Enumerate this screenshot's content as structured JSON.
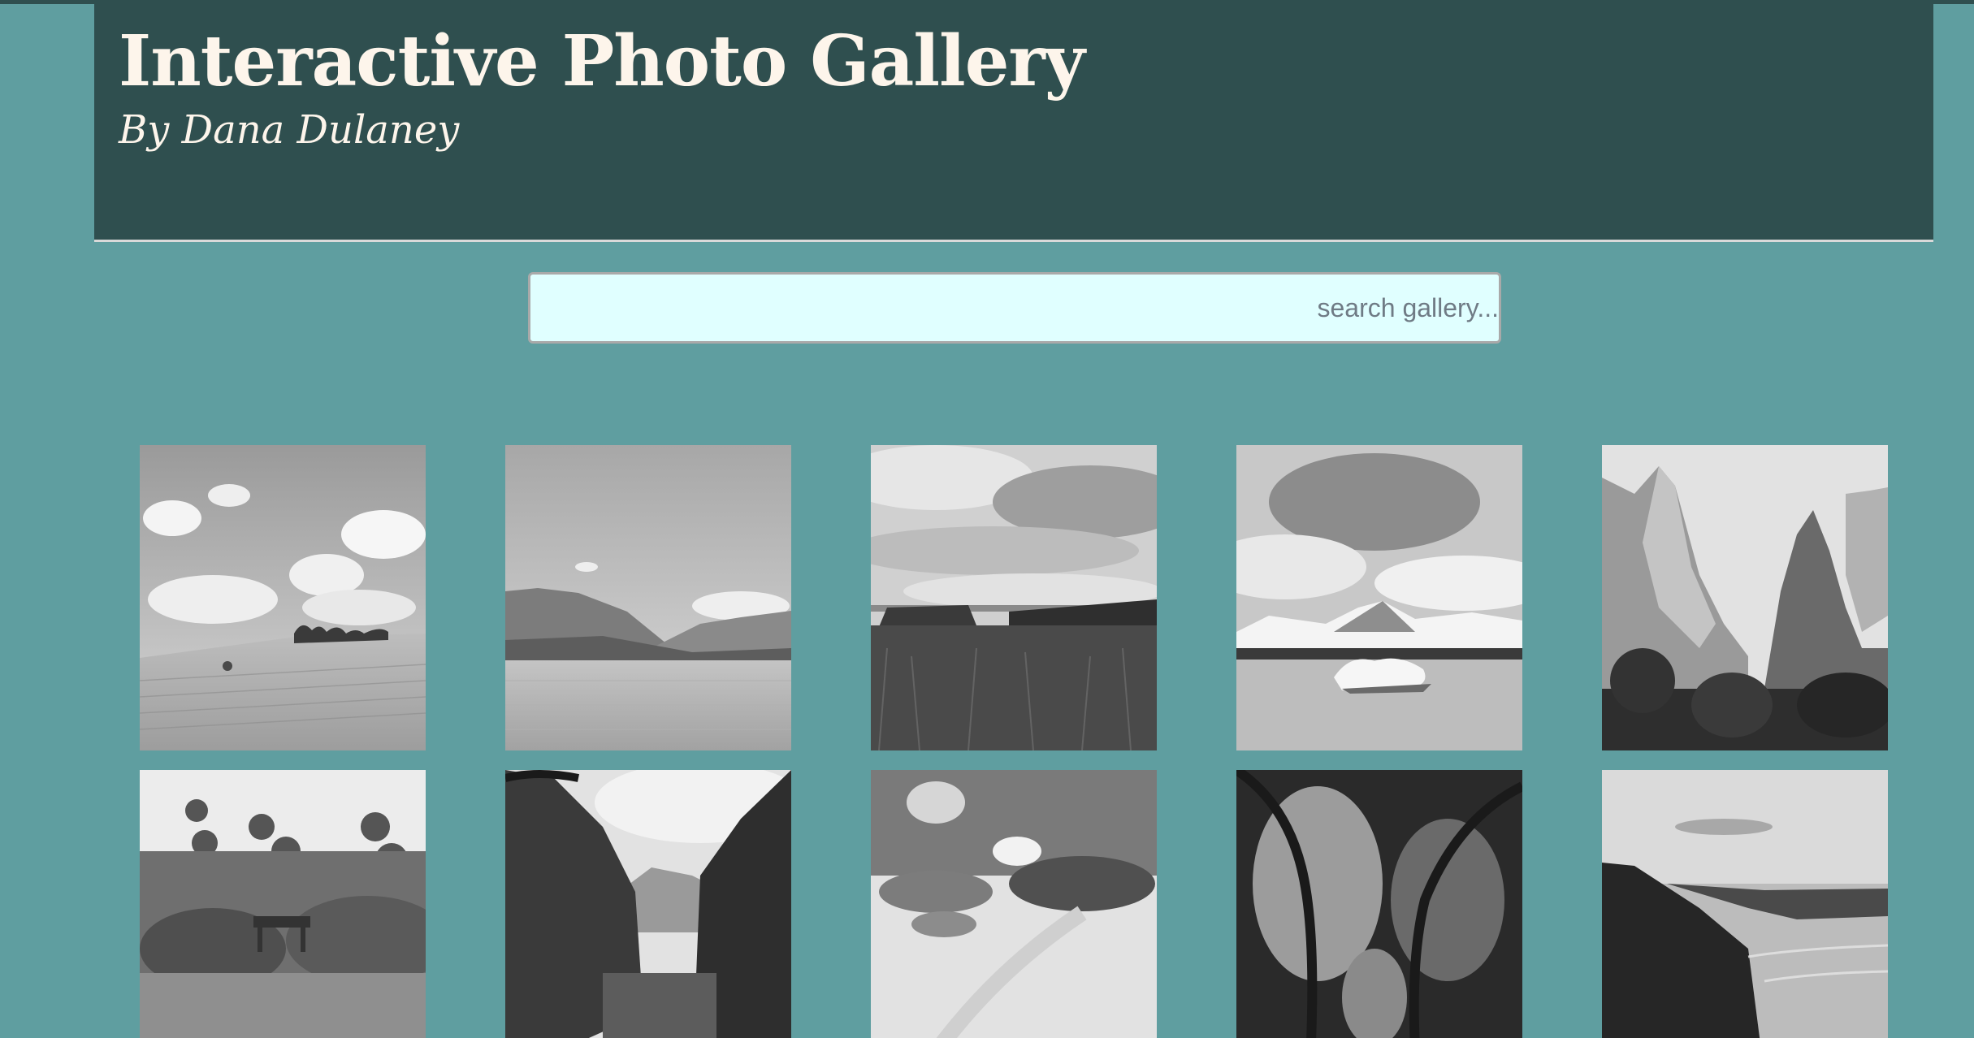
{
  "header": {
    "title": "Interactive Photo Gallery",
    "subtitle": "By Dana Dulaney"
  },
  "search": {
    "placeholder": "search gallery...",
    "value": ""
  },
  "colors": {
    "page_background": "#5f9ea0",
    "header_background": "#2f4f4f",
    "header_text": "#fdf5eb",
    "search_background": "#e0ffff"
  },
  "gallery": {
    "photos": [
      {
        "subject": "hay field under clouds"
      },
      {
        "subject": "mountain lake"
      },
      {
        "subject": "cloudy meadow"
      },
      {
        "subject": "glacier lagoon"
      },
      {
        "subject": "canyon cliffs"
      },
      {
        "subject": "trees and bench"
      },
      {
        "subject": "forest valley"
      },
      {
        "subject": "sand dunes"
      },
      {
        "subject": "forest path"
      },
      {
        "subject": "coastal cliffs"
      }
    ]
  }
}
